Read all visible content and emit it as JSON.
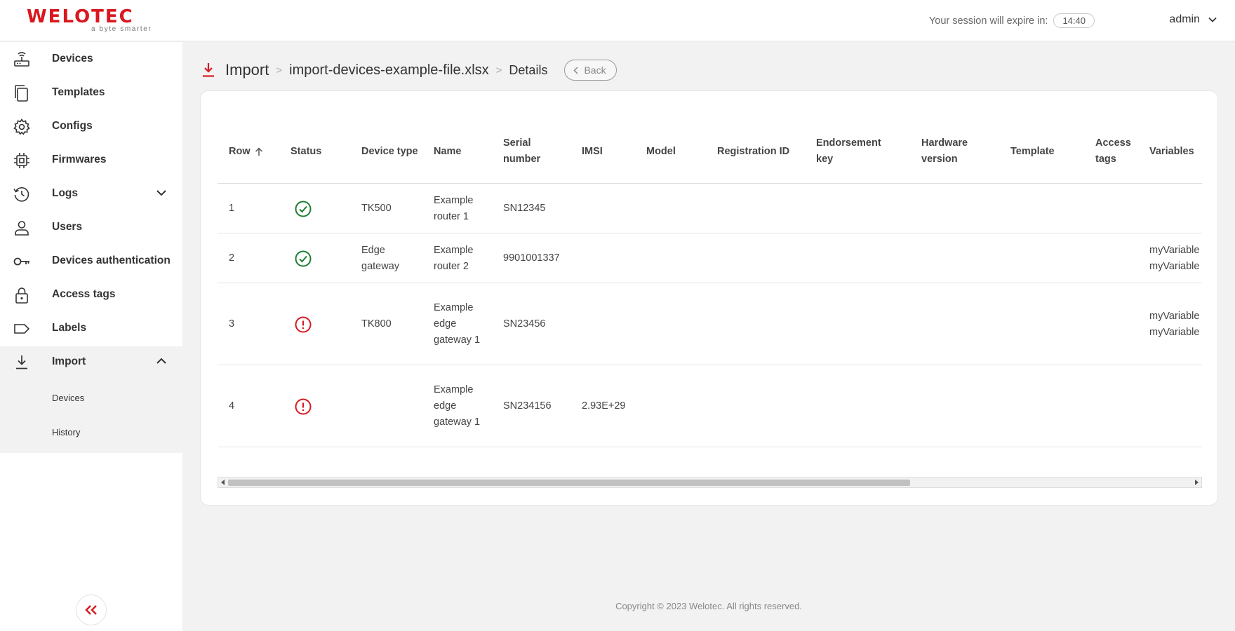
{
  "brand": {
    "name": "WELOTEC",
    "tagline": "a byte smarter",
    "accent": "#d9181f"
  },
  "header": {
    "session_label": "Your session will expire in:",
    "session_time": "14:40",
    "user": "admin"
  },
  "sidebar": {
    "items": [
      {
        "label": "Devices",
        "icon": "router-icon"
      },
      {
        "label": "Templates",
        "icon": "copy-icon"
      },
      {
        "label": "Configs",
        "icon": "gear-icon"
      },
      {
        "label": "Firmwares",
        "icon": "chip-icon"
      },
      {
        "label": "Logs",
        "icon": "history-icon",
        "expandable": true,
        "expanded": false
      },
      {
        "label": "Users",
        "icon": "user-icon"
      },
      {
        "label": "Devices authentication",
        "icon": "key-icon"
      },
      {
        "label": "Access tags",
        "icon": "lock-icon"
      },
      {
        "label": "Labels",
        "icon": "label-icon"
      },
      {
        "label": "Import",
        "icon": "download-icon",
        "expandable": true,
        "expanded": true
      }
    ],
    "import_subitems": [
      {
        "label": "Devices"
      },
      {
        "label": "History"
      }
    ]
  },
  "breadcrumb": {
    "root": "Import",
    "file": "import-devices-example-file.xlsx",
    "current": "Details",
    "separator": ">",
    "back_label": "Back"
  },
  "table": {
    "columns": [
      {
        "key": "row",
        "label": "Row",
        "sortable": true,
        "sort": "asc"
      },
      {
        "key": "status",
        "label": "Status"
      },
      {
        "key": "device_type",
        "label": "Device type"
      },
      {
        "key": "name",
        "label": "Name"
      },
      {
        "key": "serial",
        "label": "Serial number"
      },
      {
        "key": "imsi",
        "label": "IMSI"
      },
      {
        "key": "model",
        "label": "Model"
      },
      {
        "key": "registration_id",
        "label": "Registration ID"
      },
      {
        "key": "endorsement_key",
        "label": "Endorsement key"
      },
      {
        "key": "hardware_version",
        "label": "Hardware version"
      },
      {
        "key": "template",
        "label": "Template"
      },
      {
        "key": "access_tags",
        "label": "Access tags"
      },
      {
        "key": "variables",
        "label": "Variables"
      }
    ],
    "rows": [
      {
        "row": "1",
        "status": "success",
        "device_type": "TK500",
        "name": "Example router 1",
        "serial": "SN12345",
        "imsi": "",
        "model": "",
        "registration_id": "",
        "endorsement_key": "",
        "hardware_version": "",
        "template": "",
        "access_tags": "",
        "variables": []
      },
      {
        "row": "2",
        "status": "success",
        "device_type": "Edge gateway",
        "name": "Example router 2",
        "serial": "9901001337",
        "imsi": "",
        "model": "",
        "registration_id": "",
        "endorsement_key": "",
        "hardware_version": "",
        "template": "",
        "access_tags": "",
        "variables": [
          "myVariable",
          "myVariable"
        ]
      },
      {
        "row": "3",
        "status": "error",
        "device_type": "TK800",
        "name": "Example edge gateway 1",
        "serial": "SN23456",
        "imsi": "",
        "model": "",
        "registration_id": "",
        "endorsement_key": "",
        "hardware_version": "",
        "template": "",
        "access_tags": "",
        "variables": [
          "myVariable",
          "myVariable"
        ]
      },
      {
        "row": "4",
        "status": "error",
        "device_type": "",
        "name": "Example edge gateway 1",
        "serial": "SN234156",
        "imsi": "2.93E+29",
        "model": "",
        "registration_id": "",
        "endorsement_key": "",
        "hardware_version": "",
        "template": "",
        "access_tags": "",
        "variables": []
      }
    ],
    "status_colors": {
      "success": "#1e7e34",
      "error": "#d9181f"
    }
  },
  "footer": {
    "copyright": "Copyright © 2023 Welotec. All rights reserved."
  }
}
